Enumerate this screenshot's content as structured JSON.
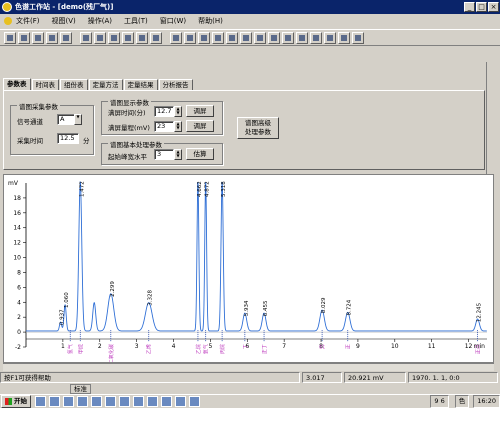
{
  "window": {
    "title": "色谱工作站 - [demo(残厂气)]"
  },
  "menu": [
    "文件(F)",
    "视图(V)",
    "操作(A)",
    "工具(T)",
    "窗口(W)",
    "帮助(H)"
  ],
  "toolbar_icons": [
    "new-icon",
    "open-icon",
    "save-icon",
    "record-icon",
    "stop-icon",
    "pause-icon",
    "run-icon",
    "print-icon",
    "preview-icon",
    "report-icon",
    "pointer-icon",
    "zoom-icon",
    "zoom-out-icon",
    "peak-icon",
    "baseline-icon",
    "integrate-icon",
    "split-icon",
    "merge-icon",
    "calibrate-icon",
    "table-icon",
    "compare-icon",
    "axis-icon",
    "label-icon",
    "color-icon",
    "exit-icon"
  ],
  "tabs": [
    "参数表",
    "时间表",
    "组份表",
    "定量方法",
    "定量结果",
    "分析报告"
  ],
  "params": {
    "acq_group": "谱图采集参数",
    "channel_label": "信号通道",
    "channel_value": "A",
    "time_label": "采集时间",
    "time_value": "12.5",
    "time_unit": "分",
    "disp_group": "谱图显示参数",
    "disp_time_label": "满屏时间(分)",
    "disp_time_value": "12.7",
    "disp_range_label": "满屏量程(mV)",
    "disp_range_value": "23",
    "adjust_label": "调屏",
    "basic_group": "谱图基本处理参数",
    "peakwidth_label": "起始峰宽水平",
    "peakwidth_value": "3",
    "estimate_label": "估算",
    "advanced_label": "谱图高级\n处理参数"
  },
  "chart_data": {
    "type": "line",
    "ylabel": "mV",
    "xlabel": "min",
    "xlim": [
      0,
      12.5
    ],
    "ylim": [
      -2,
      20
    ],
    "yticks": [
      -2,
      0,
      2,
      4,
      6,
      8,
      10,
      12,
      14,
      16,
      18
    ],
    "xticks": [
      1,
      2,
      3,
      4,
      5,
      6,
      7,
      8,
      9,
      10,
      11,
      12
    ],
    "peaks": [
      {
        "rt": 0.937,
        "height": 1.2,
        "width": 0.03,
        "label": "0.937"
      },
      {
        "rt": 1.06,
        "height": 3.5,
        "width": 0.03,
        "label": "1.060"
      },
      {
        "rt": 1.472,
        "height": 20,
        "width": 0.04,
        "label": "1.472"
      },
      {
        "rt": 1.85,
        "height": 3.8,
        "width": 0.04,
        "label": ""
      },
      {
        "rt": 2.299,
        "height": 5.0,
        "width": 0.08,
        "label": "2.299"
      },
      {
        "rt": 3.328,
        "height": 3.8,
        "width": 0.09,
        "label": "3.328"
      },
      {
        "rt": 4.662,
        "height": 20,
        "width": 0.025,
        "label": "4.662"
      },
      {
        "rt": 4.872,
        "height": 20,
        "width": 0.025,
        "label": "4.872"
      },
      {
        "rt": 5.318,
        "height": 20,
        "width": 0.03,
        "label": "5.318"
      },
      {
        "rt": 5.934,
        "height": 2.4,
        "width": 0.05,
        "label": "5.934"
      },
      {
        "rt": 6.455,
        "height": 2.4,
        "width": 0.05,
        "label": "6.455"
      },
      {
        "rt": 8.029,
        "height": 2.8,
        "width": 0.06,
        "label": "8.029"
      },
      {
        "rt": 8.724,
        "height": 2.5,
        "width": 0.06,
        "label": "8.724"
      },
      {
        "rt": 12.245,
        "height": 1.6,
        "width": 0.05,
        "label": "12.245"
      }
    ],
    "components": [
      {
        "rt": 1.2,
        "name": "氢气"
      },
      {
        "rt": 1.472,
        "name": "甲烷"
      },
      {
        "rt": 2.299,
        "name": "二氧化碳"
      },
      {
        "rt": 3.328,
        "name": "乙烯"
      },
      {
        "rt": 4.662,
        "name": "乙烷"
      },
      {
        "rt": 4.872,
        "name": "氧气"
      },
      {
        "rt": 5.318,
        "name": "丙烷"
      },
      {
        "rt": 5.934,
        "name": "丁"
      },
      {
        "rt": 6.455,
        "name": "正丁"
      },
      {
        "rt": 8.029,
        "name": "异"
      },
      {
        "rt": 8.724,
        "name": "正"
      },
      {
        "rt": 12.245,
        "name": "正己"
      }
    ],
    "colors": {
      "trace": "#2f6fd6",
      "axis": "#000000",
      "marker": "#1a3fa8",
      "name": "#c040c0"
    }
  },
  "status": {
    "help": "按F1可获得帮助",
    "time": "3.017",
    "value": "20.921 mV",
    "date": "1970. 1. 1, 0:0"
  },
  "taskbar": {
    "start": "开始",
    "ime": "标准",
    "app_label": "色",
    "tray_time": "16:20",
    "tray_label": "9 6"
  }
}
